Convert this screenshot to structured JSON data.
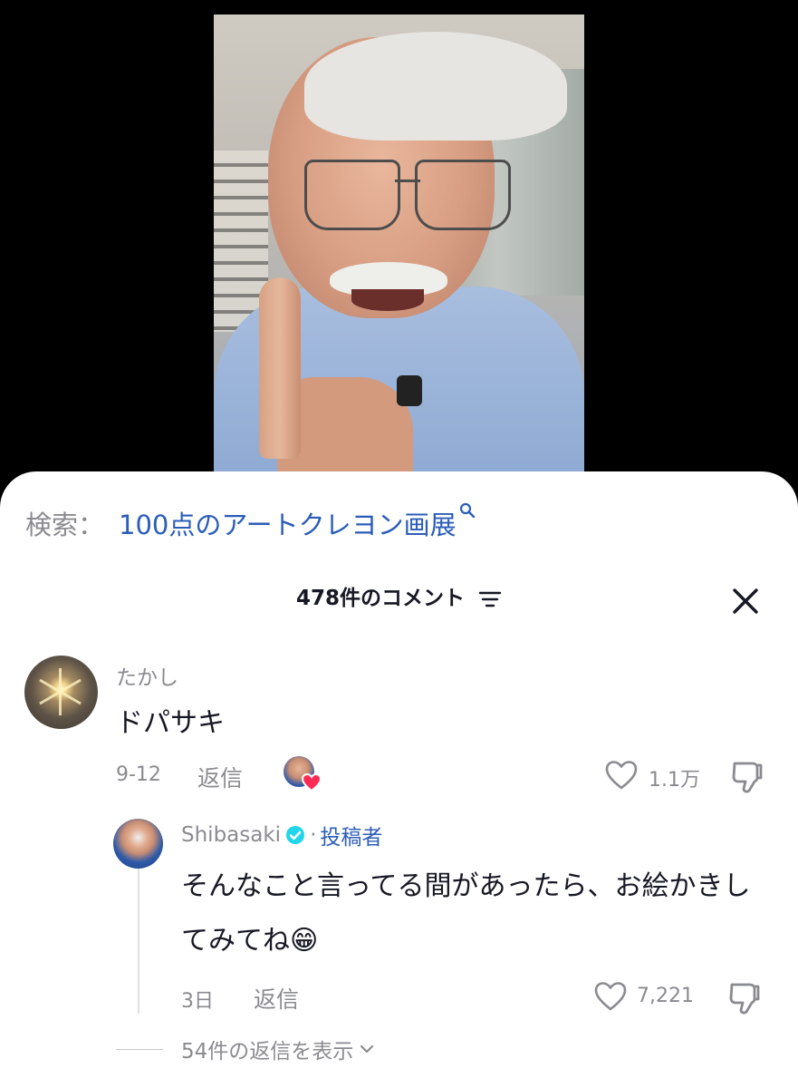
{
  "search": {
    "prefix": "検索：",
    "query": "100点のアートクレヨン画展"
  },
  "comments": {
    "count_label": "478件のコメント"
  },
  "comment_1": {
    "username": "たかし",
    "text": "ドパサキ",
    "date": "9-12",
    "reply_label": "返信",
    "likes": "1.1万"
  },
  "reply_1": {
    "username": "Shibasaki",
    "separator": "·",
    "author_badge": "投稿者",
    "text": "そんなこと言ってる間があったら、お絵かきしてみてね😁",
    "date": "3日",
    "reply_label": "返信",
    "likes": "7,221"
  },
  "view_replies_label": "54件の返信を表示",
  "colors": {
    "link": "#2b5db8",
    "muted": "#8a8b91",
    "verified": "#20d5ec",
    "heart": "#fe2c55"
  },
  "icons": [
    "search-icon",
    "sort-icon",
    "close-icon",
    "heart-icon",
    "dislike-icon",
    "verified-icon",
    "chevron-down-icon"
  ]
}
